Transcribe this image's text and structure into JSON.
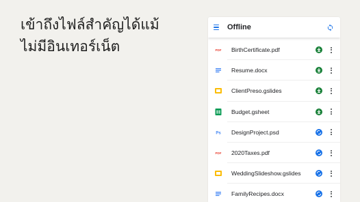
{
  "headline": {
    "line1": "เข้าถึงไฟล์สำคัญได้แม้",
    "line2": "ไม่มีอินเทอร์เน็ต"
  },
  "appbar": {
    "title": "Offline",
    "menu_icon": "hamburger-menu-icon",
    "sync_icon": "sync-icon"
  },
  "colors": {
    "accent": "#1a73e8",
    "offline_ready": "#188038",
    "syncing": "#1a73e8",
    "pdf": "#ea4335",
    "docs": "#4285f4",
    "slides": "#fbbc04",
    "sheets": "#0f9d58",
    "psd": "#4285f4"
  },
  "files": [
    {
      "name": "BirthCertificate.pdf",
      "type": "pdf",
      "type_label": "PDF",
      "status": "offline-ready"
    },
    {
      "name": "Resume.docx",
      "type": "docs",
      "type_label": "",
      "status": "offline-ready"
    },
    {
      "name": "ClientPreso.gslides",
      "type": "slides",
      "type_label": "",
      "status": "offline-ready"
    },
    {
      "name": "Budget.gsheet",
      "type": "sheets",
      "type_label": "",
      "status": "offline-ready"
    },
    {
      "name": "DesignProject.psd",
      "type": "psd",
      "type_label": "Ps",
      "status": "syncing"
    },
    {
      "name": "2020Taxes.pdf",
      "type": "pdf",
      "type_label": "PDF",
      "status": "syncing"
    },
    {
      "name": "WeddingSlideshow.gslides",
      "type": "slides",
      "type_label": "",
      "status": "syncing"
    },
    {
      "name": "FamilyRecipes.docx",
      "type": "docs",
      "type_label": "",
      "status": "syncing"
    }
  ]
}
